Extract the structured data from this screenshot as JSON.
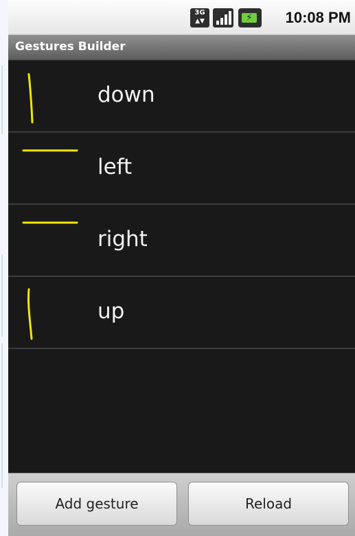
{
  "status_bar": {
    "network_label": "3G",
    "time": "10:08 PM"
  },
  "title_bar": {
    "title": "Gestures Builder"
  },
  "gestures": [
    {
      "label": "down"
    },
    {
      "label": "left"
    },
    {
      "label": "right"
    },
    {
      "label": "up"
    }
  ],
  "actions": {
    "add_label": "Add gesture",
    "reload_label": "Reload"
  },
  "colors": {
    "gesture_stroke": "#f2e600",
    "list_background": "#191919"
  }
}
